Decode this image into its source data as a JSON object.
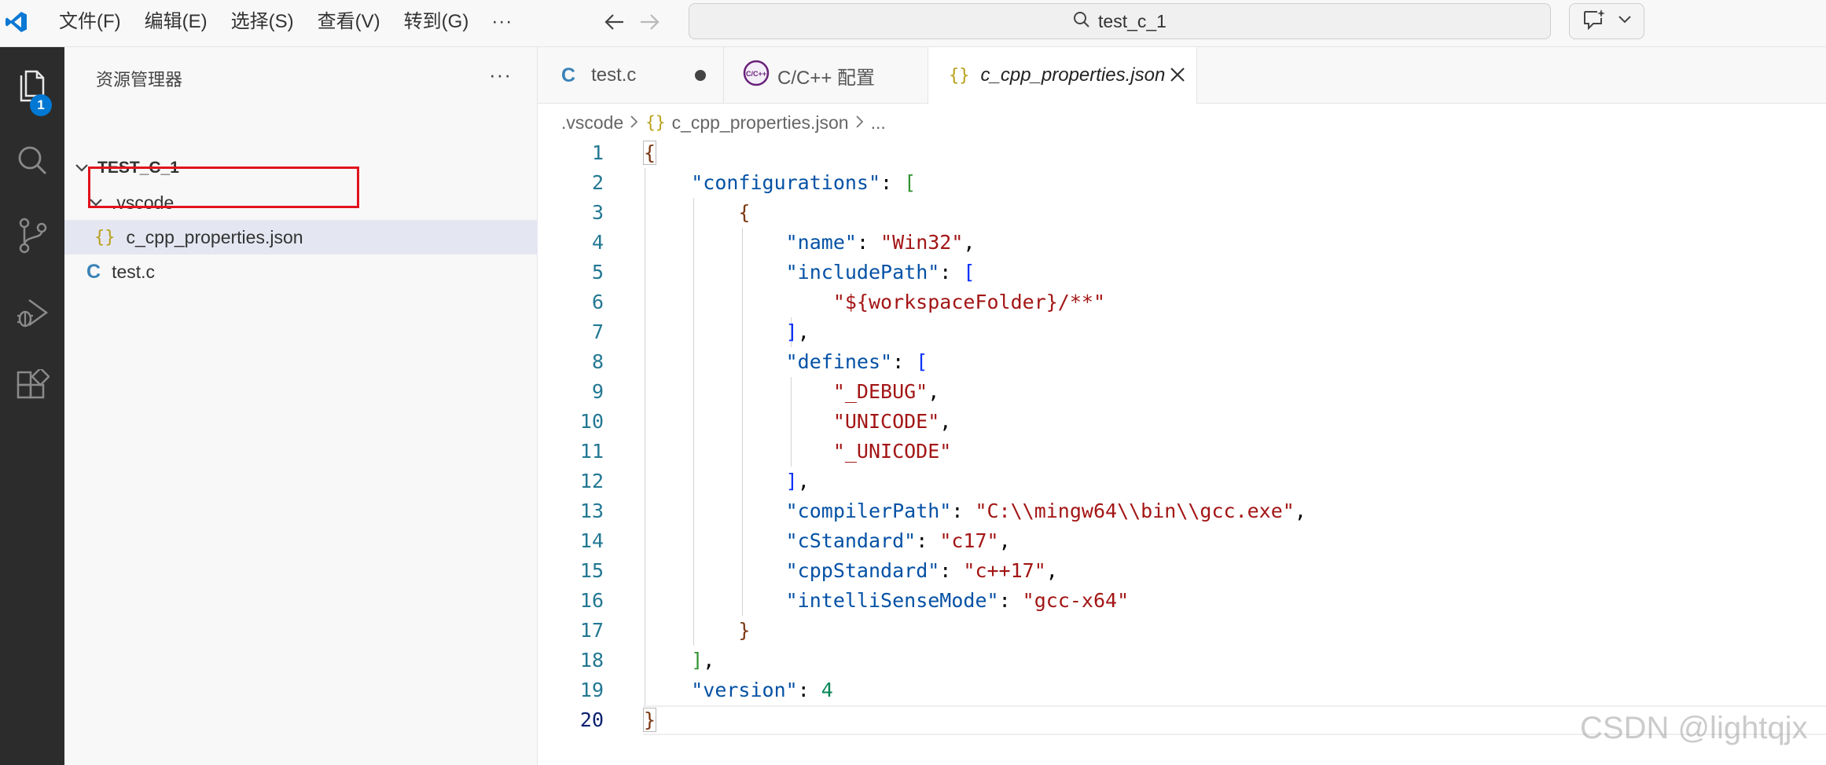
{
  "menu": [
    "文件(F)",
    "编辑(E)",
    "选择(S)",
    "查看(V)",
    "转到(G)",
    "···"
  ],
  "search": {
    "text": "test_c_1"
  },
  "activity": {
    "explorer_badge": "1"
  },
  "sidebar": {
    "title": "资源管理器",
    "more": "···",
    "root": "TEST_C_1",
    "folder": ".vscode",
    "files": [
      {
        "name": "c_cpp_properties.json",
        "glyph": "{}"
      },
      {
        "name": "test.c",
        "glyph": "C"
      }
    ]
  },
  "tabs": [
    {
      "label": "test.c",
      "glyph": "C"
    },
    {
      "label": "C/C++ 配置",
      "glyph": "C/C++"
    },
    {
      "label": "c_cpp_properties.json",
      "glyph": "{}"
    }
  ],
  "breadcrumb": {
    "folder": ".vscode",
    "file": "c_cpp_properties.json",
    "tail": "..."
  },
  "editor": {
    "line_numbers": [
      "1",
      "2",
      "3",
      "4",
      "5",
      "6",
      "7",
      "8",
      "9",
      "10",
      "11",
      "12",
      "13",
      "14",
      "15",
      "16",
      "17",
      "18",
      "19",
      "20"
    ]
  },
  "colors": {
    "activity_bg": "#2c2c2c",
    "badge": "#0078d4",
    "highlight_box": "#e1131d",
    "json_key": "#0451a5",
    "json_string": "#a31515",
    "json_number": "#098658"
  },
  "watermark": "CSDN @lightqjx"
}
